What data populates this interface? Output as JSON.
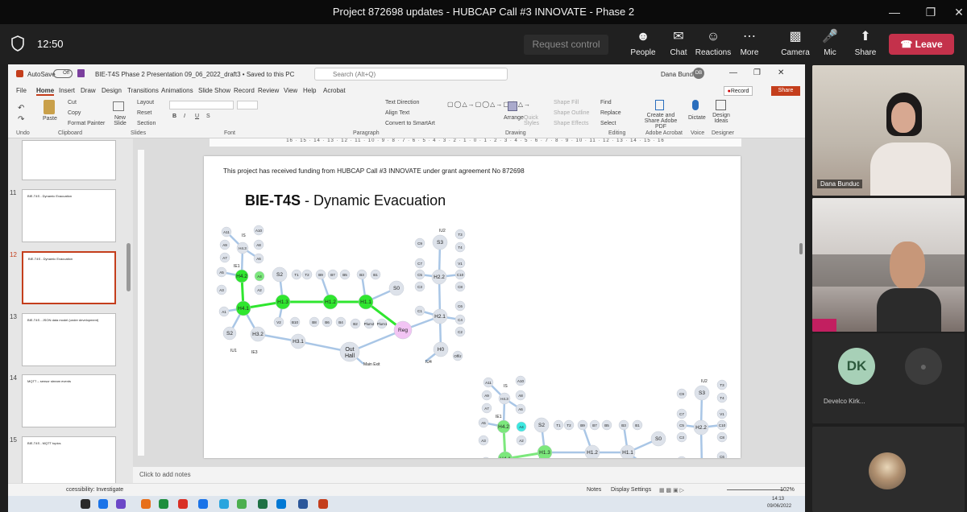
{
  "window": {
    "title": "Project 872698 updates - HUBCAP Call #3 INNOVATE - Phase 2"
  },
  "meeting": {
    "time": "12:50",
    "request_control": "Request control",
    "buttons": {
      "people": "People",
      "chat": "Chat",
      "reactions": "Reactions",
      "more": "More",
      "camera": "Camera",
      "mic": "Mic",
      "share": "Share"
    },
    "leave": "Leave"
  },
  "ppt": {
    "autosave": "AutoSave",
    "autosave_state": "Off",
    "file_title": "BIE-T4S Phase 2 Presentation 09_06_2022_draft3 • Saved to this PC",
    "search_placeholder": "Search (Alt+Q)",
    "user": "Dana Bunduc",
    "user_initials": "DB",
    "tabs": [
      "File",
      "Home",
      "Insert",
      "Draw",
      "Design",
      "Transitions",
      "Animations",
      "Slide Show",
      "Record",
      "Review",
      "View",
      "Help",
      "Acrobat"
    ],
    "record_btn": "Record",
    "share_btn": "Share",
    "ribbon": {
      "undo": "Undo",
      "clipboard": "Clipboard",
      "slides": "Slides",
      "font": "Font",
      "paragraph": "Paragraph",
      "drawing": "Drawing",
      "editing": "Editing",
      "adobe": "Adobe Acrobat",
      "voice": "Voice",
      "designer": "Designer",
      "paste": "Paste",
      "cut": "Cut",
      "copy": "Copy",
      "format_painter": "Format Painter",
      "new_slide": "New Slide",
      "layout": "Layout",
      "reset": "Reset",
      "section": "Section",
      "text_direction": "Text Direction",
      "align_text": "Align Text",
      "convert_smartart": "Convert to SmartArt",
      "arrange": "Arrange",
      "quick_styles": "Quick Styles",
      "shape_fill": "Shape Fill",
      "shape_outline": "Shape Outline",
      "shape_effects": "Shape Effects",
      "find": "Find",
      "replace": "Replace",
      "select": "Select",
      "create_share": "Create and Share Adobe PDF",
      "dictate": "Dictate",
      "design_ideas": "Design Ideas"
    },
    "thumbnails": [
      {
        "num": "11",
        "title": "BIE-T4S - Dynamic Evacuation"
      },
      {
        "num": "12",
        "title": "BIE-T4S - Dynamic Evacuation"
      },
      {
        "num": "13",
        "title": "BIE-T4S - JSON data model (under development)"
      },
      {
        "num": "14",
        "title": "MQTT – sensor stream events"
      },
      {
        "num": "15",
        "title": "BIE-T4S - MQTT topics"
      }
    ],
    "ruler": "16 · 15 · 14 · 13 · 12 · 11 · 10 · 9 · 8 · 7 · 6 · 5 · 4 · 3 · 2 · 1 · 0 · 1 · 2 · 3 · 4 · 5 · 6 · 7 · 8 · 9 · 10 · 11 · 12 · 13 · 14 · 15 · 16",
    "notes_placeholder": "Click to add notes",
    "status": {
      "accessibility": "ccessibility: Investigate",
      "notes": "Notes",
      "display": "Display Settings",
      "zoom": "102%"
    },
    "taskbar_time": "14:13",
    "taskbar_date": "09/06/2022"
  },
  "slide": {
    "funding": "This project has received funding from HUBCAP Call #3 INNOVATE under grant agreement No 872698",
    "title_bold": "BIE-T4S",
    "title_rest": " - Dynamic Evacuation",
    "labels": {
      "main_exit": "Main Exit",
      "out": "Out",
      "hall": "Hall"
    }
  },
  "participants": [
    {
      "name": "Dana Bunduc",
      "initials": "DB"
    },
    {
      "name": "",
      "initials": ""
    },
    {
      "name": "Develco Kirk...",
      "initials": "DK"
    },
    {
      "name": "",
      "initials": ""
    }
  ],
  "colors": {
    "leave": "#c4314b",
    "green": "#2fe62f",
    "pale_green": "#7ce87c",
    "pink": "#ee66ee",
    "orange": "#f07a2c",
    "node_grey": "#dde2ea"
  }
}
